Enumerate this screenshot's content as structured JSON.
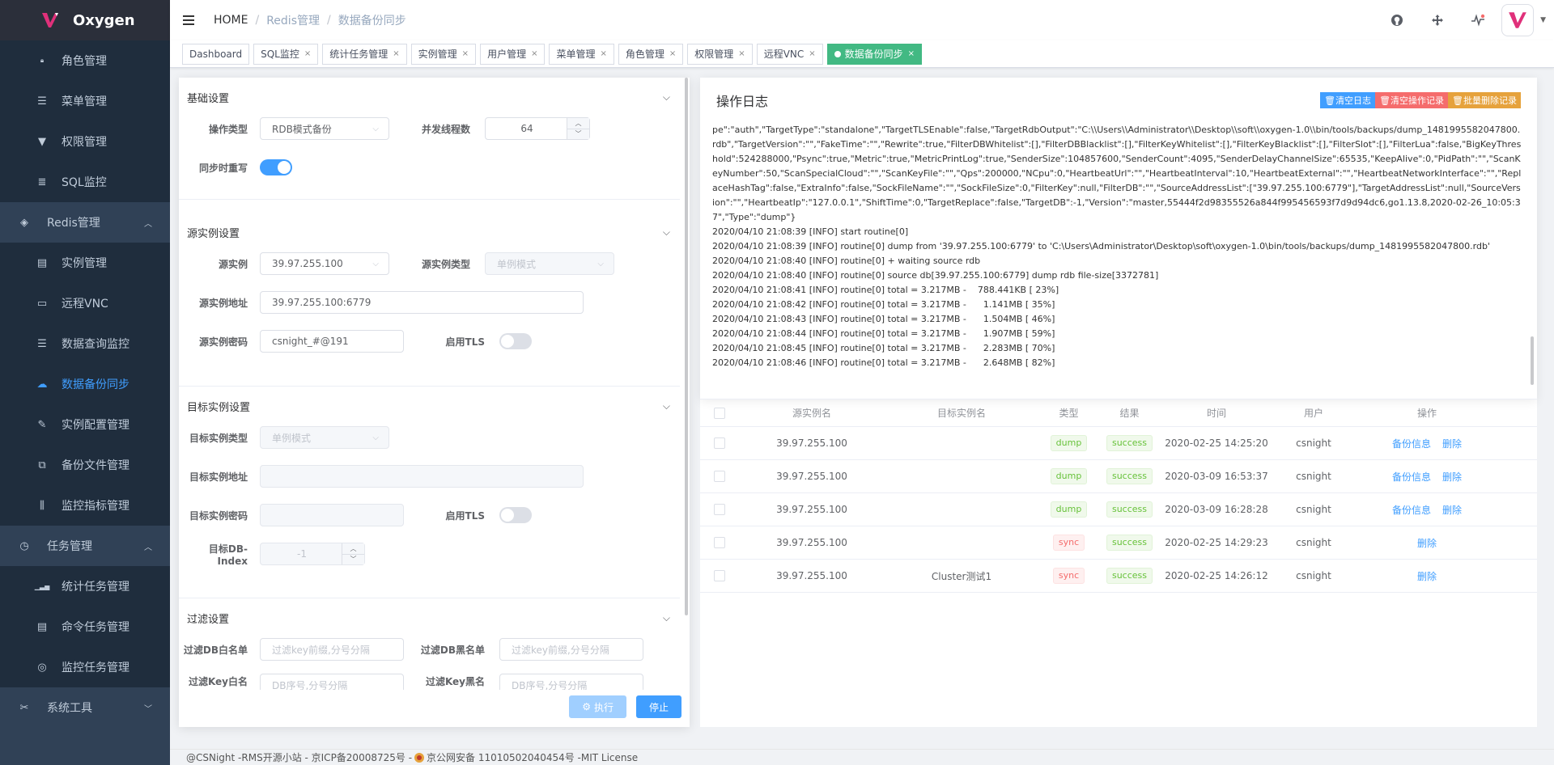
{
  "app": {
    "name": "Oxygen"
  },
  "sidebar": {
    "items": [
      {
        "label": "角色管理",
        "icon": "lock-icon",
        "glyph": "🔒︎",
        "level": "sub",
        "active": false
      },
      {
        "label": "菜单管理",
        "icon": "list-icon",
        "glyph": "☰",
        "level": "sub",
        "active": false
      },
      {
        "label": "权限管理",
        "icon": "stamp-icon",
        "glyph": "▼",
        "level": "sub",
        "active": false
      },
      {
        "label": "SQL监控",
        "icon": "database-icon",
        "glyph": "≣",
        "level": "sub",
        "active": false
      },
      {
        "label": "Redis管理",
        "icon": "layers-icon",
        "glyph": "◈",
        "level": "top",
        "expanded": true
      },
      {
        "label": "实例管理",
        "icon": "server-icon",
        "glyph": "▤",
        "level": "sub",
        "active": false
      },
      {
        "label": "远程VNC",
        "icon": "monitor-icon",
        "glyph": "▭",
        "level": "sub",
        "active": false
      },
      {
        "label": "数据查询监控",
        "icon": "list-icon",
        "glyph": "☰",
        "level": "sub",
        "active": false
      },
      {
        "label": "数据备份同步",
        "icon": "cloud-upload-icon",
        "glyph": "☁",
        "level": "sub",
        "active": true
      },
      {
        "label": "实例配置管理",
        "icon": "wrench-icon",
        "glyph": "✎",
        "level": "sub",
        "active": false
      },
      {
        "label": "备份文件管理",
        "icon": "files-icon",
        "glyph": "⧉",
        "level": "sub",
        "active": false
      },
      {
        "label": "监控指标管理",
        "icon": "sliders-icon",
        "glyph": "⫼",
        "level": "sub",
        "active": false
      },
      {
        "label": "任务管理",
        "icon": "timer-icon",
        "glyph": "◷",
        "level": "top",
        "expanded": true
      },
      {
        "label": "统计任务管理",
        "icon": "chart-icon",
        "glyph": "▁▃▅",
        "level": "sub",
        "active": false
      },
      {
        "label": "命令任务管理",
        "icon": "terminal-icon",
        "glyph": "▤",
        "level": "sub",
        "active": false
      },
      {
        "label": "监控任务管理",
        "icon": "radar-icon",
        "glyph": "◎",
        "level": "sub",
        "active": false
      },
      {
        "label": "系统工具",
        "icon": "tools-icon",
        "glyph": "✂",
        "level": "top",
        "expanded": false
      }
    ]
  },
  "header": {
    "breadcrumb": [
      "HOME",
      "Redis管理",
      "数据备份同步"
    ]
  },
  "tags": {
    "items": [
      {
        "label": "Dashboard",
        "closable": false,
        "active": false
      },
      {
        "label": "SQL监控",
        "closable": true,
        "active": false
      },
      {
        "label": "统计任务管理",
        "closable": true,
        "active": false
      },
      {
        "label": "实例管理",
        "closable": true,
        "active": false
      },
      {
        "label": "用户管理",
        "closable": true,
        "active": false
      },
      {
        "label": "菜单管理",
        "closable": true,
        "active": false
      },
      {
        "label": "角色管理",
        "closable": true,
        "active": false
      },
      {
        "label": "权限管理",
        "closable": true,
        "active": false
      },
      {
        "label": "远程VNC",
        "closable": true,
        "active": false
      },
      {
        "label": "数据备份同步",
        "closable": true,
        "active": true
      }
    ]
  },
  "form": {
    "basic": {
      "title": "基础设置",
      "op_type_label": "操作类型",
      "op_type_value": "RDB模式备份",
      "threads_label": "并发线程数",
      "threads_value": "64",
      "rewrite_label": "同步时重写",
      "rewrite_on": true
    },
    "source": {
      "title": "源实例设置",
      "instance_label": "源实例",
      "instance_value": "39.97.255.100",
      "type_label": "源实例类型",
      "type_value": "单例模式",
      "addr_label": "源实例地址",
      "addr_value": "39.97.255.100:6779",
      "pwd_label": "源实例密码",
      "pwd_value": "csnight_#@191",
      "tls_label": "启用TLS",
      "tls_on": false
    },
    "target": {
      "title": "目标实例设置",
      "type_label": "目标实例类型",
      "type_value": "单例模式",
      "addr_label": "目标实例地址",
      "addr_value": "",
      "pwd_label": "目标实例密码",
      "pwd_value": "",
      "tls_label": "启用TLS",
      "tls_on": false,
      "db_label": "目标DB-Index",
      "db_value": "-1"
    },
    "filter": {
      "title": "过滤设置",
      "db_white_label": "过滤DB白名单",
      "db_white_placeholder": "过滤key前缀,分号分隔",
      "db_black_label": "过滤DB黑名单",
      "db_black_placeholder": "过滤key前缀,分号分隔",
      "key_white_label": "过滤Key白名单",
      "key_white_placeholder": "DB序号,分号分隔",
      "key_black_label": "过滤Key黑名单",
      "key_black_placeholder": "DB序号,分号分隔"
    },
    "exec_label": "执行",
    "stop_label": "停止"
  },
  "log": {
    "title": "操作日志",
    "clear_log_label": "清空日志",
    "clear_ops_label": "清空操作记录",
    "batch_delete_label": "批量删除记录",
    "lines": [
      "pe\":\"auth\",\"TargetType\":\"standalone\",\"TargetTLSEnable\":false,\"TargetRdbOutput\":\"C:\\\\Users\\\\Administrator\\\\Desktop\\\\soft\\\\oxygen-1.0\\\\bin/tools/backups/dump_1481995582047800.rdb\",\"TargetVersion\":\"\",\"FakeTime\":\"\",\"Rewrite\":true,\"FilterDBWhitelist\":[],\"FilterDBBlacklist\":[],\"FilterKeyWhitelist\":[],\"FilterKeyBlacklist\":[],\"FilterSlot\":[],\"FilterLua\":false,\"BigKeyThreshold\":524288000,\"Psync\":true,\"Metric\":true,\"MetricPrintLog\":true,\"SenderSize\":104857600,\"SenderCount\":4095,\"SenderDelayChannelSize\":65535,\"KeepAlive\":0,\"PidPath\":\"\",\"ScanKeyNumber\":50,\"ScanSpecialCloud\":\"\",\"ScanKeyFile\":\"\",\"Qps\":200000,\"NCpu\":0,\"HeartbeatUrl\":\"\",\"HeartbeatInterval\":10,\"HeartbeatExternal\":\"\",\"HeartbeatNetworkInterface\":\"\",\"ReplaceHashTag\":false,\"ExtraInfo\":false,\"SockFileName\":\"\",\"SockFileSize\":0,\"FilterKey\":null,\"FilterDB\":\"\",\"SourceAddressList\":[\"39.97.255.100:6779\"],\"TargetAddressList\":null,\"SourceVersion\":\"\",\"HeartbeatIp\":\"127.0.0.1\",\"ShiftTime\":0,\"TargetReplace\":false,\"TargetDB\":-1,\"Version\":\"master,55444f2d98355526a844f995456593f7d9d94dc6,go1.13.8,2020-02-26_10:05:37\",\"Type\":\"dump\"}",
      "2020/04/10 21:08:39 [INFO] start routine[0]",
      "2020/04/10 21:08:39 [INFO] routine[0] dump from '39.97.255.100:6779' to 'C:\\Users\\Administrator\\Desktop\\soft\\oxygen-1.0\\bin/tools/backups/dump_1481995582047800.rdb'",
      "2020/04/10 21:08:40 [INFO] routine[0] + waiting source rdb",
      "2020/04/10 21:08:40 [INFO] routine[0] source db[39.97.255.100:6779] dump rdb file-size[3372781]",
      "2020/04/10 21:08:41 [INFO] routine[0] total = 3.217MB -    788.441KB [ 23%]",
      "2020/04/10 21:08:42 [INFO] routine[0] total = 3.217MB -      1.141MB [ 35%]",
      "2020/04/10 21:08:43 [INFO] routine[0] total = 3.217MB -      1.504MB [ 46%]",
      "2020/04/10 21:08:44 [INFO] routine[0] total = 3.217MB -      1.907MB [ 59%]",
      "2020/04/10 21:08:45 [INFO] routine[0] total = 3.217MB -      2.283MB [ 70%]",
      "2020/04/10 21:08:46 [INFO] routine[0] total = 3.217MB -      2.648MB [ 82%]"
    ]
  },
  "table": {
    "headers": [
      "源实例名",
      "目标实例名",
      "类型",
      "结果",
      "时间",
      "用户",
      "操作"
    ],
    "rows": [
      {
        "source": "39.97.255.100",
        "target": "",
        "type": "dump",
        "result": "success",
        "time": "2020-02-25 14:25:20",
        "user": "csnight",
        "actions": [
          "备份信息",
          "删除"
        ]
      },
      {
        "source": "39.97.255.100",
        "target": "",
        "type": "dump",
        "result": "success",
        "time": "2020-03-09 16:53:37",
        "user": "csnight",
        "actions": [
          "备份信息",
          "删除"
        ]
      },
      {
        "source": "39.97.255.100",
        "target": "",
        "type": "dump",
        "result": "success",
        "time": "2020-03-09 16:28:28",
        "user": "csnight",
        "actions": [
          "备份信息",
          "删除"
        ]
      },
      {
        "source": "39.97.255.100",
        "target": "",
        "type": "sync",
        "result": "success",
        "time": "2020-02-25 14:29:23",
        "user": "csnight",
        "actions": [
          "删除"
        ]
      },
      {
        "source": "39.97.255.100",
        "target": "Cluster测试1",
        "type": "sync",
        "result": "success",
        "time": "2020-02-25 14:26:12",
        "user": "csnight",
        "actions": [
          "删除"
        ]
      }
    ]
  },
  "footer": {
    "left": "@CSNight -RMS开源小站 - 京ICP备20008725号 -",
    "right": "京公网安备 11010502040454号 -MIT License"
  },
  "colors": {
    "sidebar_bg": "#304156",
    "accent": "#409eff",
    "active_tag": "#42b983"
  }
}
